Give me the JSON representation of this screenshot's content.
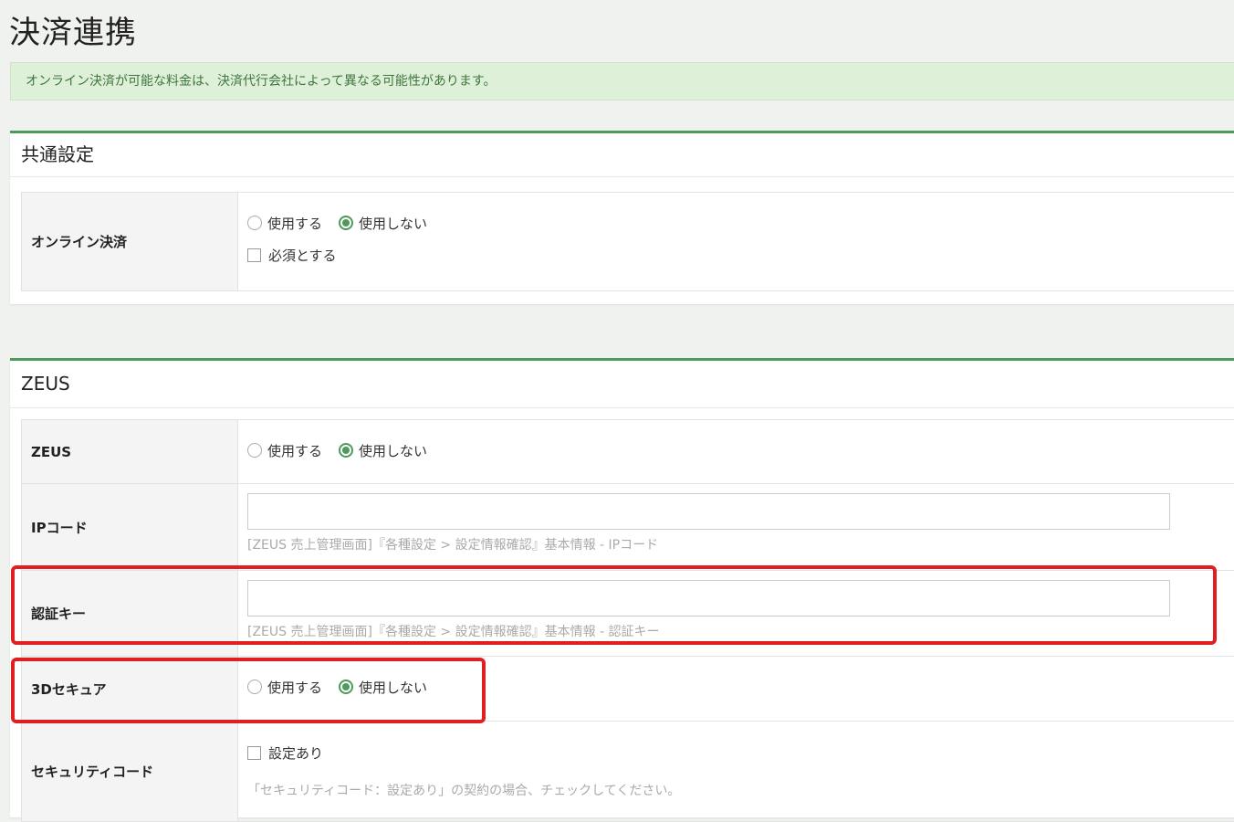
{
  "page": {
    "title": "決済連携"
  },
  "alert": {
    "text": "オンライン決済が可能な料金は、決済代行会社によって異なる可能性があります。"
  },
  "common": {
    "heading": "共通設定",
    "online_payment": {
      "label": "オンライン決済",
      "options": [
        "使用する",
        "使用しない"
      ],
      "selected": "使用しない",
      "required_label": "必須とする"
    }
  },
  "zeus": {
    "heading": "ZEUS",
    "enable": {
      "label": "ZEUS",
      "options": [
        "使用する",
        "使用しない"
      ],
      "selected": "使用しない"
    },
    "ip_code": {
      "label": "IPコード",
      "value": "",
      "hint": "[ZEUS 売上管理画面]『各種設定 > 設定情報確認』基本情報 - IPコード"
    },
    "auth_key": {
      "label": "認証キー",
      "value": "",
      "hint": "[ZEUS 売上管理画面]『各種設定 > 設定情報確認』基本情報 - 認証キー"
    },
    "secure3d": {
      "label": "3Dセキュア",
      "options": [
        "使用する",
        "使用しない"
      ],
      "selected": "使用しない"
    },
    "security_code": {
      "label": "セキュリティコード",
      "checkbox_label": "設定あり",
      "note": "「セキュリティコード：設定あり」の契約の場合、チェックしてください。"
    }
  },
  "colors": {
    "accent": "#4e9a5c",
    "highlight": "#e02020",
    "alert_bg": "#dff0d8"
  }
}
